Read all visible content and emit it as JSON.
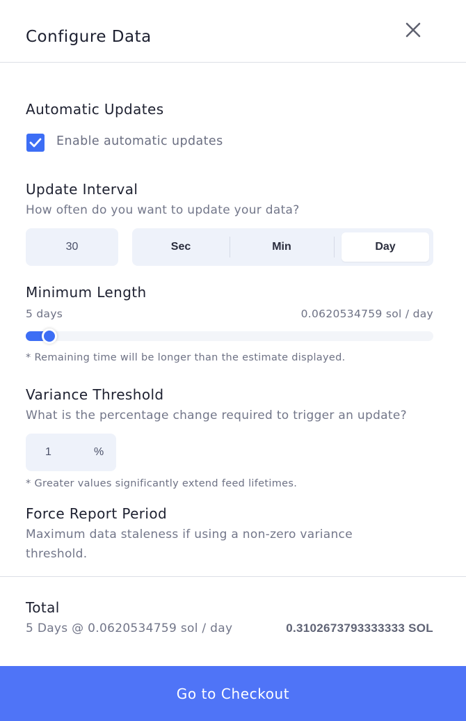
{
  "modal": {
    "title": "Configure Data",
    "close_icon": "close-icon"
  },
  "automatic_updates": {
    "heading": "Automatic Updates",
    "checkbox_label": "Enable automatic updates",
    "checked": true
  },
  "update_interval": {
    "heading": "Update Interval",
    "description": "How often do you want to update your data?",
    "value": "30",
    "units": [
      {
        "label": "Sec",
        "selected": false
      },
      {
        "label": "Min",
        "selected": false
      },
      {
        "label": "Day",
        "selected": true
      }
    ]
  },
  "minimum_length": {
    "heading": "Minimum Length",
    "length_label": "5 days",
    "rate_label": "0.0620534759 sol / day",
    "slider_fraction": 0.04,
    "note": "* Remaining time will be longer than the estimate displayed."
  },
  "variance_threshold": {
    "heading": "Variance Threshold",
    "description": "What is the percentage change required to trigger an update?",
    "value": "1",
    "unit": "%",
    "note": "* Greater values significantly extend feed lifetimes."
  },
  "force_report_period": {
    "heading": "Force Report Period",
    "description": "Maximum data staleness if using a non-zero variance threshold."
  },
  "total": {
    "heading": "Total",
    "summary": "5 Days @ 0.0620534759 sol / day",
    "amount": "0.3102673793333333 SOL"
  },
  "checkout_button": "Go to Checkout",
  "colors": {
    "accent": "#3d6ef5",
    "checkout": "#4f74f7",
    "input_bg": "#eef2fa"
  }
}
